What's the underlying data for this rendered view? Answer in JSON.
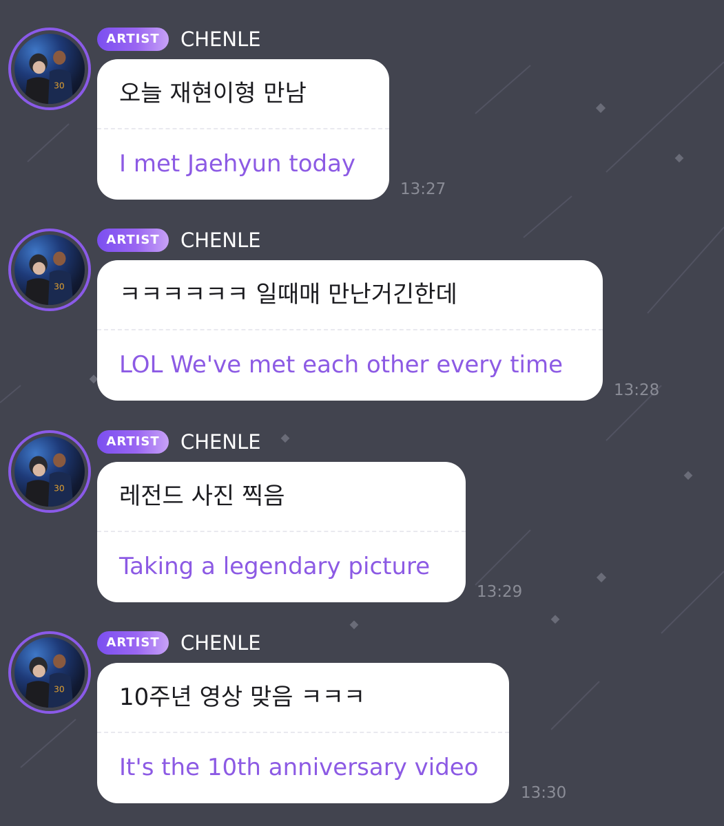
{
  "theme": {
    "background": "#42444f",
    "bubble": "#ffffff",
    "translation_color": "#8c5ae4",
    "badge_gradient_start": "#7b4ff0",
    "badge_gradient_end": "#c7a2f7"
  },
  "messages": [
    {
      "badge": "ARTIST",
      "sender": "CHENLE",
      "text_ko": "오늘 재현이형 만남",
      "text_en": "I met Jaehyun today",
      "time": "13:27"
    },
    {
      "badge": "ARTIST",
      "sender": "CHENLE",
      "text_ko": "ㅋㅋㅋㅋㅋㅋ 일때매 만난거긴한데",
      "text_en": "LOL We've met each other every time",
      "time": "13:28"
    },
    {
      "badge": "ARTIST",
      "sender": "CHENLE",
      "text_ko": "레전드 사진 찍음",
      "text_en": "Taking a legendary picture",
      "time": "13:29"
    },
    {
      "badge": "ARTIST",
      "sender": "CHENLE",
      "text_ko": "10주년 영상 맞음 ㅋㅋㅋ",
      "text_en": "It's the 10th anniversary video",
      "time": "13:30"
    }
  ]
}
